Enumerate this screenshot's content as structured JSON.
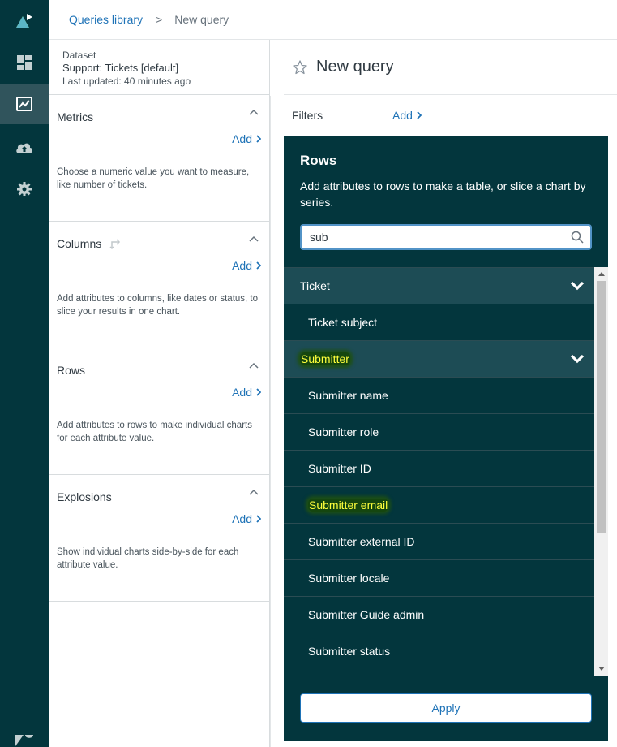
{
  "breadcrumb": {
    "library": "Queries library",
    "separator": ">",
    "current": "New query"
  },
  "dataset": {
    "label": "Dataset",
    "name": "Support: Tickets [default]",
    "updated": "Last updated: 40 minutes ago"
  },
  "sections": [
    {
      "title": "Metrics",
      "add": "Add",
      "desc": "Choose a numeric value you want to measure, like number of tickets."
    },
    {
      "title": "Columns",
      "add": "Add",
      "desc": "Add attributes to columns, like dates or status, to slice your results in one chart."
    },
    {
      "title": "Rows",
      "add": "Add",
      "desc": "Add attributes to rows to make individual charts for each attribute value."
    },
    {
      "title": "Explosions",
      "add": "Add",
      "desc": "Show individual charts side-by-side for each attribute value."
    }
  ],
  "query": {
    "title": "New query",
    "filters_label": "Filters",
    "filters_add": "Add"
  },
  "rows_popover": {
    "title": "Rows",
    "desc": "Add attributes to rows to make a table, or slice a chart by series.",
    "search_value": "sub",
    "groups": [
      {
        "label": "Ticket",
        "items": [
          "Ticket subject"
        ]
      },
      {
        "label": "Submitter",
        "items": [
          "Submitter name",
          "Submitter role",
          "Submitter ID",
          "Submitter email",
          "Submitter external ID",
          "Submitter locale",
          "Submitter Guide admin",
          "Submitter status"
        ]
      }
    ],
    "apply": "Apply"
  },
  "colors": {
    "nav_bg": "#03363d",
    "nav_active": "#30545c",
    "link": "#1f73b7",
    "popover_bg": "#03363d",
    "group_bg": "#1d4c55",
    "highlight": "#ffff3c"
  }
}
